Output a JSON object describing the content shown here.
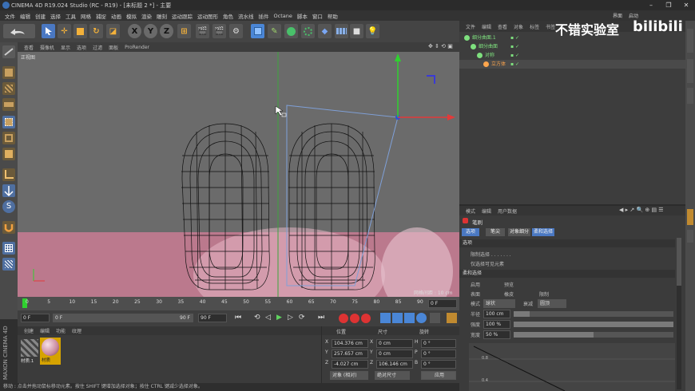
{
  "window": {
    "title": "CINEMA 4D R19.024 Studio (RC - R19) - [未标题 2 *] - 主要",
    "controls": [
      "–",
      "❐",
      "✕"
    ]
  },
  "menubar": [
    "文件",
    "编辑",
    "创建",
    "选择",
    "工具",
    "网格",
    "捕捉",
    "动画",
    "模拟",
    "渲染",
    "雕刻",
    "运动跟踪",
    "运动图形",
    "角色",
    "流水线",
    "插件",
    "Octane",
    "脚本",
    "窗口",
    "帮助"
  ],
  "layout_label": "界面",
  "layout_value": "启动",
  "watermark": {
    "channel": "不错实验室",
    "brand": "bilibili"
  },
  "toolbar": {
    "axis_x": "X",
    "axis_y": "Y",
    "axis_z": "Z"
  },
  "viewport": {
    "menu": [
      "查看",
      "摄像机",
      "显示",
      "选项",
      "过滤",
      "面板",
      "ProRender"
    ],
    "view_label": "正视图",
    "grid_label": "网格间距 : 10 cm"
  },
  "timeline": {
    "ticks": [
      "0",
      "5",
      "10",
      "15",
      "20",
      "25",
      "30",
      "35",
      "40",
      "45",
      "50",
      "55",
      "60",
      "65",
      "70",
      "75",
      "80",
      "85",
      "90"
    ],
    "current_frame": "0 F"
  },
  "transport": {
    "start": "0 F",
    "min": "0 F",
    "max": "90 F",
    "end": "90 F"
  },
  "material": {
    "menu": [
      "创建",
      "编辑",
      "功能",
      "纹理"
    ],
    "items": [
      {
        "name": "材质.1"
      },
      {
        "name": "材质"
      }
    ]
  },
  "coords": {
    "headers": [
      "位置",
      "尺寸",
      "旋转"
    ],
    "rows": [
      {
        "axis": "X",
        "pos": "104.376 cm",
        "size_axis": "X",
        "size": "0 cm",
        "rot_axis": "H",
        "rot": "0 °"
      },
      {
        "axis": "Y",
        "pos": "257.657 cm",
        "size_axis": "Y",
        "size": "0 cm",
        "rot_axis": "P",
        "rot": "0 °"
      },
      {
        "axis": "Z",
        "pos": "-4.027 cm",
        "size_axis": "Z",
        "size": "106.146 cm",
        "rot_axis": "B",
        "rot": "0 °"
      }
    ],
    "mode": "对象 (相对)",
    "size_mode": "绝对尺寸",
    "apply": "应用"
  },
  "objmgr": {
    "menu": [
      "文件",
      "编辑",
      "查看",
      "对象",
      "标签",
      "书签"
    ],
    "rows": [
      {
        "name": "细分曲面.1",
        "indent": 0,
        "color": "#7ee07e"
      },
      {
        "name": "细分曲面",
        "indent": 1,
        "color": "#7ee07e"
      },
      {
        "name": "对称",
        "indent": 2,
        "color": "#7ee07e"
      },
      {
        "name": "立方体",
        "indent": 3,
        "color": "#ffa64d"
      }
    ]
  },
  "attrmgr": {
    "menu": [
      "模式",
      "编辑",
      "用户数据"
    ],
    "title": "笔刷",
    "tabs": [
      "选项",
      "笔尖",
      "对象细分",
      "柔和选择"
    ],
    "section1": "选项",
    "opt1": "限制选择 . . . . . . .",
    "opt2": "仅选择可见元素",
    "section2": "柔和选择",
    "row_enable": "启用",
    "row_preview": "预览",
    "row_surface": "表面",
    "row_rubber": "橡皮",
    "row_restrict": "限制",
    "row_mode_label": "模式",
    "row_mode_value": "球状",
    "row_falloff_label": "衰减",
    "row_falloff_value": "圆顶",
    "radius_label": "半径",
    "radius_value": "100 cm",
    "strength_label": "强度",
    "strength_value": "100 %",
    "width_label": "宽度",
    "width_value": "50 %",
    "graph_ticks": [
      "0.8",
      "0.4"
    ]
  },
  "status": "移动 : 点击并拖动鼠标移动元素。按住 SHIFT 键增加选择对象；按住 CTRL 键减少选择对象。",
  "maxon": "MAXON CINEMA 4D",
  "colors": {
    "accent_blue": "#3c7bd1",
    "selection_pink": "#d97a94",
    "axis_red": "#e23a3a",
    "axis_green": "#2fd12f"
  }
}
